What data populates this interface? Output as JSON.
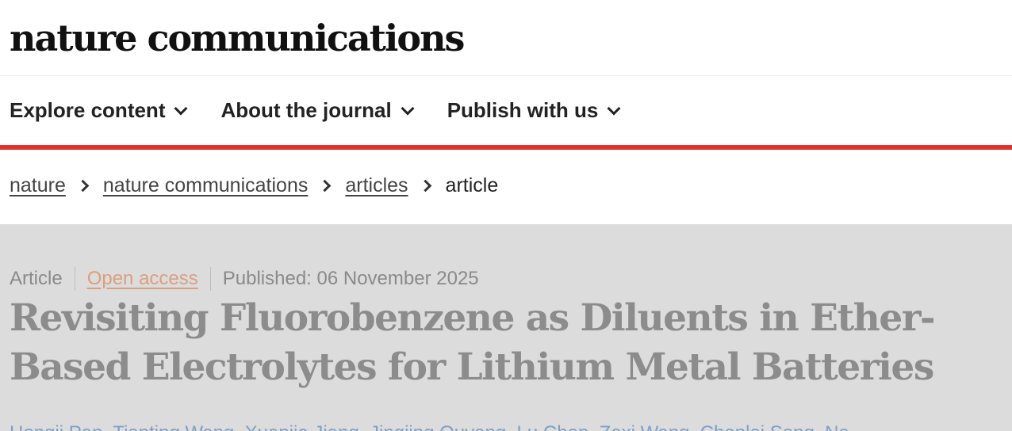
{
  "header": {
    "logo_text": "nature communications"
  },
  "nav": {
    "items": [
      {
        "label": "Explore content"
      },
      {
        "label": "About the journal"
      },
      {
        "label": "Publish with us"
      }
    ],
    "accent_color": "#e0332e"
  },
  "breadcrumb": {
    "items": [
      "nature",
      "nature communications",
      "articles"
    ],
    "current": "article"
  },
  "article": {
    "type": "Article",
    "access": "Open access",
    "published": "Published: 06 November 2025",
    "title": "Revisiting Fluorobenzene as Diluents in Ether-Based Electrolytes for Lithium Metal Batteries",
    "authors_partial": "Hongji Pan, Tianting Wang, Xuanjie Jiang, Jingjing Ouyang, Lu Chen, Zexi Wang, Chenlei Song, Na"
  }
}
